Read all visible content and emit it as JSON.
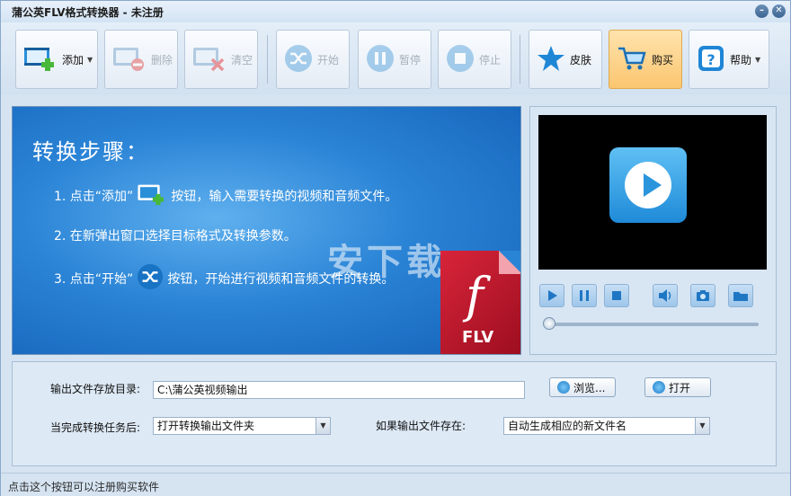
{
  "window": {
    "title": "蒲公英FLV格式转换器 - 未注册",
    "minimize_glyph": "–",
    "close_glyph": "✕"
  },
  "toolbar": {
    "add_label": "添加",
    "delete_label": "删除",
    "clear_label": "清空",
    "start_label": "开始",
    "pause_label": "暂停",
    "stop_label": "停止",
    "skin_label": "皮肤",
    "buy_label": "购买",
    "help_label": "帮助",
    "dropdown_glyph": "▼"
  },
  "steps": {
    "title": "转换步骤：",
    "step1_prefix": "1. 点击“添加”",
    "step1_suffix": "按钮，输入需要转换的视频和音频文件。",
    "step2": "2. 在新弹出窗口选择目标格式及转换参数。",
    "step3_prefix": "3. 点击“开始”",
    "step3_suffix": "按钮，开始进行视频和音频文件的转换。",
    "badge_text": "FLV",
    "badge_glyph": "f",
    "watermark": "安下载"
  },
  "player": {
    "seek_position": 0
  },
  "settings": {
    "output_dir_label": "输出文件存放目录:",
    "output_dir_value": "C:\\蒲公英视频输出",
    "browse_label": "浏览...",
    "open_label": "打开",
    "after_task_label": "当完成转换任务后:",
    "after_task_value": "打开转换输出文件夹",
    "if_exists_label": "如果输出文件存在:",
    "if_exists_value": "自动生成相应的新文件名"
  },
  "status": {
    "text": "点击这个按钮可以注册购买软件"
  },
  "colors": {
    "accent": "#1f8ad8",
    "buy_bg": "#fbc670",
    "flv_red": "#c81c30"
  }
}
